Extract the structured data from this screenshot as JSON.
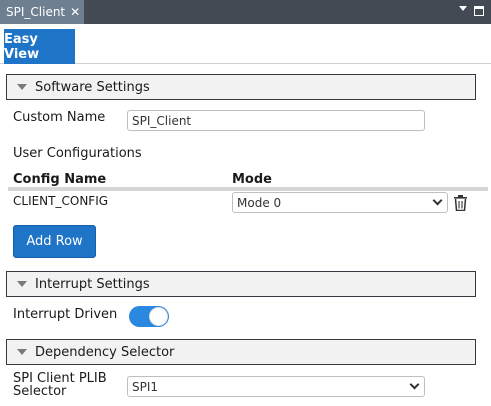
{
  "window": {
    "tab_title": "SPI_Client",
    "close_glyph": "✕"
  },
  "view_tabs": {
    "easy_view": "Easy View"
  },
  "software": {
    "header": "Software Settings",
    "custom_name_label": "Custom Name",
    "custom_name_value": "SPI_Client",
    "user_config_label": "User Configurations",
    "table": {
      "headers": [
        "Config Name",
        "Mode"
      ],
      "rows": [
        {
          "config_name": "CLIENT_CONFIG",
          "mode": "Mode 0"
        }
      ]
    },
    "add_row_label": "Add Row"
  },
  "interrupt": {
    "header": "Interrupt Settings",
    "driven_label": "Interrupt Driven",
    "driven_on": true
  },
  "dependency": {
    "header": "Dependency Selector",
    "plib_label_line1": "SPI Client PLIB",
    "plib_label_line2": "Selector",
    "plib_value": "SPI1"
  },
  "colors": {
    "accent": "#1e74c6",
    "titlebar": "#434a53",
    "toggle_on": "#2a88e0"
  }
}
